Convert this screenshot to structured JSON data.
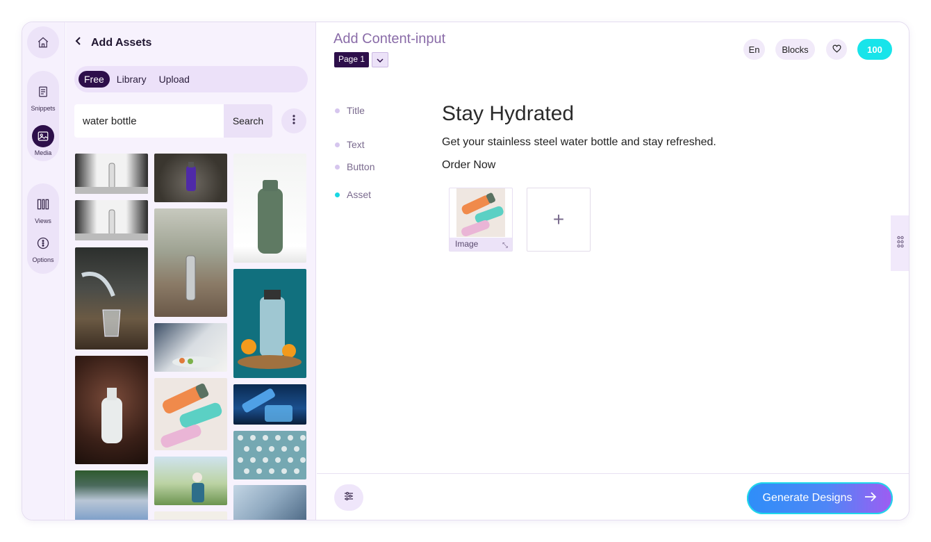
{
  "rail": {
    "snippets": "Snippets",
    "media": "Media",
    "views": "Views",
    "options": "Options"
  },
  "assets": {
    "title": "Add Assets",
    "tabs": [
      "Free",
      "Library",
      "Upload"
    ],
    "search_value": "water bottle",
    "search_button": "Search"
  },
  "main": {
    "title": "Add Content-input",
    "page_label": "Page 1",
    "lang": "En",
    "blocks": "Blocks",
    "credits": "100",
    "fields": {
      "title_label": "Title",
      "text_label": "Text",
      "button_label": "Button",
      "asset_label": "Asset"
    },
    "content": {
      "title": "Stay Hydrated",
      "text": "Get your stainless steel water bottle and stay refreshed.",
      "button": "Order Now",
      "asset_caption": "Image",
      "add_symbol": "+"
    },
    "generate": "Generate Designs"
  },
  "colors": {
    "accent_dark": "#2d0f4a",
    "credits": "#18e4ea",
    "active_dot": "#19d7e3"
  }
}
